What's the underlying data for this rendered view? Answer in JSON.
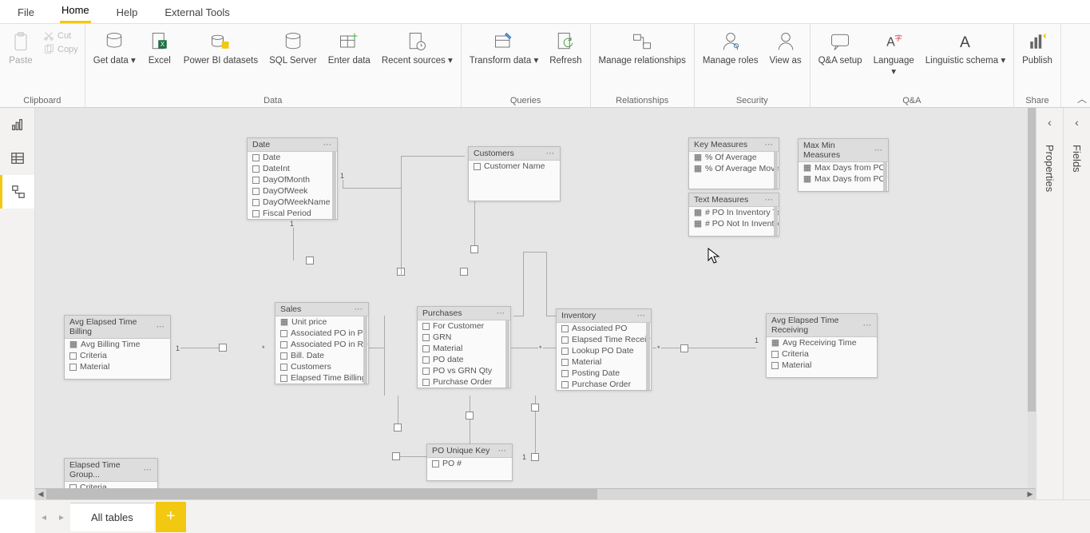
{
  "tabs": {
    "file": "File",
    "home": "Home",
    "help": "Help",
    "external": "External Tools"
  },
  "ribbon": {
    "clipboard": {
      "paste": "Paste",
      "cut": "Cut",
      "copy": "Copy",
      "label": "Clipboard"
    },
    "data": {
      "get": "Get data",
      "excel": "Excel",
      "pbi": "Power BI datasets",
      "sql": "SQL Server",
      "enter": "Enter data",
      "recent": "Recent sources",
      "label": "Data"
    },
    "queries": {
      "transform": "Transform data",
      "refresh": "Refresh",
      "label": "Queries"
    },
    "relationships": {
      "manage": "Manage relationships",
      "label": "Relationships"
    },
    "security": {
      "roles": "Manage roles",
      "viewas": "View as",
      "label": "Security"
    },
    "qa": {
      "setup": "Q&A setup",
      "language": "Language",
      "schema": "Linguistic schema",
      "label": "Q&A"
    },
    "share": {
      "publish": "Publish",
      "label": "Share"
    }
  },
  "tables": {
    "date": {
      "title": "Date",
      "fields": [
        "Date",
        "DateInt",
        "DayOfMonth",
        "DayOfWeek",
        "DayOfWeekName",
        "Fiscal Period"
      ]
    },
    "customers": {
      "title": "Customers",
      "fields": [
        "Customer Name"
      ]
    },
    "keymeasures": {
      "title": "Key Measures",
      "fields": [
        "% Of Average",
        "% Of Average Moving"
      ]
    },
    "maxmin": {
      "title": "Max Min Measures",
      "fields": [
        "Max Days from PO to ...",
        "Max Days from PO to ..."
      ]
    },
    "textmeasures": {
      "title": "Text Measures",
      "fields": [
        "# PO In Inventory Text",
        "# PO Not In Inventory ..."
      ]
    },
    "avgbilling": {
      "title": "Avg Elapsed Time Billing",
      "fields": [
        "Avg Billing Time",
        "Criteria",
        "Material"
      ]
    },
    "sales": {
      "title": "Sales",
      "fields": [
        "Unit price",
        "Associated PO in Purchas...",
        "Associated PO in Receiving",
        "Bill. Date",
        "Customers",
        "Elapsed Time Billing"
      ]
    },
    "purchases": {
      "title": "Purchases",
      "fields": [
        "For Customer",
        "GRN",
        "Material",
        "PO date",
        "PO vs GRN Qty",
        "Purchase Order"
      ]
    },
    "inventory": {
      "title": "Inventory",
      "fields": [
        "Associated PO",
        "Elapsed Time Receiving",
        "Lookup PO Date",
        "Material",
        "Posting Date",
        "Purchase Order"
      ]
    },
    "avgreceiving": {
      "title": "Avg Elapsed Time Receiving",
      "fields": [
        "Avg Receiving Time",
        "Criteria",
        "Material"
      ]
    },
    "elapsedgroup": {
      "title": "Elapsed Time Group...",
      "fields": [
        "Criteria"
      ]
    },
    "pounique": {
      "title": "PO Unique Key",
      "fields": [
        "PO #"
      ]
    }
  },
  "bottom": {
    "alltables": "All tables"
  },
  "rightPanels": {
    "properties": "Properties",
    "fields": "Fields"
  }
}
